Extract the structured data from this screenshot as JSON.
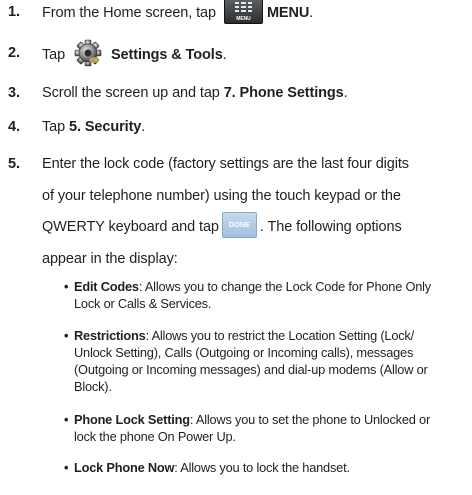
{
  "steps": [
    {
      "num": "1.",
      "pre": "From the Home screen, tap",
      "icon": "menu-icon",
      "icon_label": "MENU",
      "bold": "MENU",
      "post": "."
    },
    {
      "num": "2.",
      "pre": "Tap",
      "icon": "gear-icon",
      "bold": "Settings & Tools",
      "post": "."
    },
    {
      "num": "3.",
      "pre": "Scroll the screen up and tap ",
      "bold": "7. Phone Settings",
      "post": "."
    },
    {
      "num": "4.",
      "pre": "Tap ",
      "bold": "5. Security",
      "post": "."
    },
    {
      "num": "5.",
      "line1": "Enter the lock code (factory settings are the last four digits",
      "line2": "of your telephone number) using the touch keypad or the",
      "line3_pre": "QWERTY keyboard and tap",
      "done_label": "DONE",
      "line3_post": ". The following options",
      "line4": "appear in the display:"
    }
  ],
  "bullets": [
    {
      "term": "Edit Codes",
      "line1": ": Allows you to change the Lock Code for Phone Only",
      "line2": "Lock or Calls & Services."
    },
    {
      "term": "Restrictions",
      "line1": ": Allows you to restrict the Location Setting (Lock/",
      "line2": "Unlock Setting), Calls (Outgoing or Incoming calls), messages",
      "line3": "(Outgoing or Incoming messages) and dial-up modems (Allow or",
      "line4": "Block)."
    },
    {
      "term": "Phone Lock Setting",
      "line1": ": Allows you to set the phone to Unlocked or",
      "line2": "lock the phone On Power Up."
    },
    {
      "term": "Lock Phone Now",
      "line1": ": Allows you to lock the handset."
    }
  ],
  "bullet_glyph": "•"
}
